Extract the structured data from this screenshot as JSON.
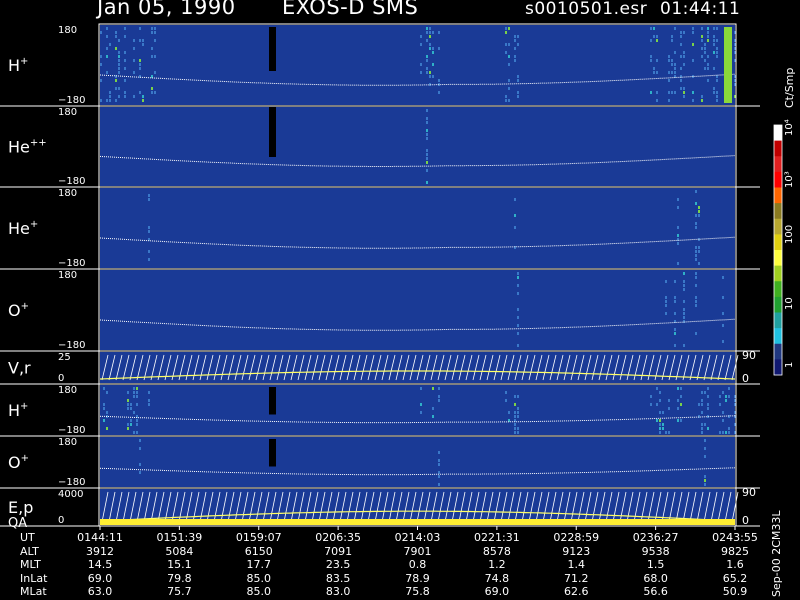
{
  "header": {
    "date": "Jan 05, 1990",
    "instrument": "EXOS-D SMS",
    "file": "s0010501.esr",
    "time": "01:44:11"
  },
  "colorbar": {
    "unit": "Ct/Smp",
    "tick_labels": [
      "10⁴",
      "10³",
      "100",
      "10",
      "1"
    ]
  },
  "footer_note": "Sep-00 2CM33L",
  "colors": {
    "background": "#000000",
    "panel_fill": "#1a3a96",
    "trace": "#ffffff",
    "attitude": "#ffff66"
  },
  "chart_data": {
    "type": "heatmap",
    "panels": [
      {
        "label": "H",
        "sup": "+",
        "y_labels": [
          "180",
          "−180"
        ],
        "ylim": [
          -180,
          180
        ]
      },
      {
        "label": "He",
        "sup": "++",
        "y_labels": [
          "180",
          "−180"
        ],
        "ylim": [
          -180,
          180
        ]
      },
      {
        "label": "He",
        "sup": "+",
        "y_labels": [
          "180",
          "−180"
        ],
        "ylim": [
          -180,
          180
        ]
      },
      {
        "label": "O",
        "sup": "+",
        "y_labels": [
          "180",
          "−180"
        ],
        "ylim": [
          -180,
          180
        ]
      },
      {
        "label": "V,r",
        "sup": "",
        "y_labels": [
          "25",
          "0"
        ],
        "right_label": "90",
        "right_label2": "0"
      },
      {
        "label": "H",
        "sup": "+",
        "y_labels": [
          "180",
          "−180"
        ],
        "ylim": [
          -180,
          180
        ]
      },
      {
        "label": "O",
        "sup": "+",
        "y_labels": [
          "180",
          "−180"
        ],
        "ylim": [
          -180,
          180
        ]
      },
      {
        "label": "E,p",
        "sup": "",
        "label2": "QA",
        "y_labels": [
          "4000",
          "0"
        ],
        "right_label": "90",
        "right_label2": "0"
      }
    ],
    "x_ticks": [
      "0144:11",
      "0151:39",
      "0159:07",
      "0206:35",
      "0214:03",
      "0221:31",
      "0228:59",
      "0236:27",
      "0243:55"
    ],
    "ephemeris": [
      {
        "name": "UT",
        "values": [
          "0144:11",
          "0151:39",
          "0159:07",
          "0206:35",
          "0214:03",
          "0221:31",
          "0228:59",
          "0236:27",
          "0243:55"
        ]
      },
      {
        "name": "ALT",
        "values": [
          "3912",
          "5084",
          "6150",
          "7091",
          "7901",
          "8578",
          "9123",
          "9538",
          "9825"
        ]
      },
      {
        "name": "MLT",
        "values": [
          "14.5",
          "15.1",
          "17.7",
          "23.5",
          "0.8",
          "1.2",
          "1.4",
          "1.5",
          "1.6"
        ]
      },
      {
        "name": "InLat",
        "values": [
          "69.0",
          "79.8",
          "85.0",
          "83.5",
          "78.9",
          "74.8",
          "71.2",
          "68.0",
          "65.2"
        ]
      },
      {
        "name": "MLat",
        "values": [
          "63.0",
          "75.7",
          "85.0",
          "83.0",
          "75.8",
          "69.0",
          "62.6",
          "56.6",
          "50.9"
        ]
      }
    ]
  }
}
